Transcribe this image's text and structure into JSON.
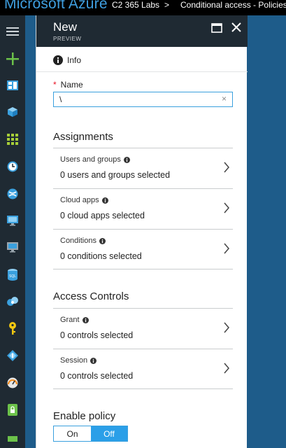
{
  "topbar": {
    "brand": "Microsoft Azure",
    "tenant": "C2 365 Labs",
    "separator": ">",
    "breadcrumb": "Conditional access - Policies"
  },
  "rail": {
    "items": [
      {
        "icon": "hamburger-icon"
      },
      {
        "icon": "plus-icon"
      },
      {
        "icon": "dashboard-icon"
      },
      {
        "icon": "cube-icon"
      },
      {
        "icon": "all-resources-icon"
      },
      {
        "icon": "clock-icon"
      },
      {
        "icon": "globe-icon"
      },
      {
        "icon": "virtual-machine-icon"
      },
      {
        "icon": "monitor-icon"
      },
      {
        "icon": "sql-icon"
      },
      {
        "icon": "cosmos-icon"
      },
      {
        "icon": "key-icon"
      },
      {
        "icon": "diamond-icon"
      },
      {
        "icon": "gauge-icon"
      },
      {
        "icon": "security-icon"
      },
      {
        "icon": "partial-icon"
      }
    ]
  },
  "blade": {
    "title": "New",
    "subtitle": "PREVIEW",
    "info_label": "Info",
    "name_label": "Name",
    "required_marker": "*",
    "name_value": "\\",
    "clear_glyph": "×",
    "assignments_title": "Assignments",
    "assignments": [
      {
        "label": "Users and groups",
        "value": "0 users and groups selected"
      },
      {
        "label": "Cloud apps",
        "value": "0 cloud apps selected"
      },
      {
        "label": "Conditions",
        "value": "0 conditions selected"
      }
    ],
    "access_title": "Access Controls",
    "access": [
      {
        "label": "Grant",
        "value": "0 controls selected"
      },
      {
        "label": "Session",
        "value": "0 controls selected"
      }
    ],
    "enable_title": "Enable policy",
    "toggle": {
      "on": "On",
      "off": "Off",
      "selected": "Off"
    }
  },
  "colors": {
    "brand": "#3f9fe0",
    "accent": "#2b9fe8",
    "rail_bg": "#1f2a33",
    "backdrop": "#1e5c8a"
  }
}
